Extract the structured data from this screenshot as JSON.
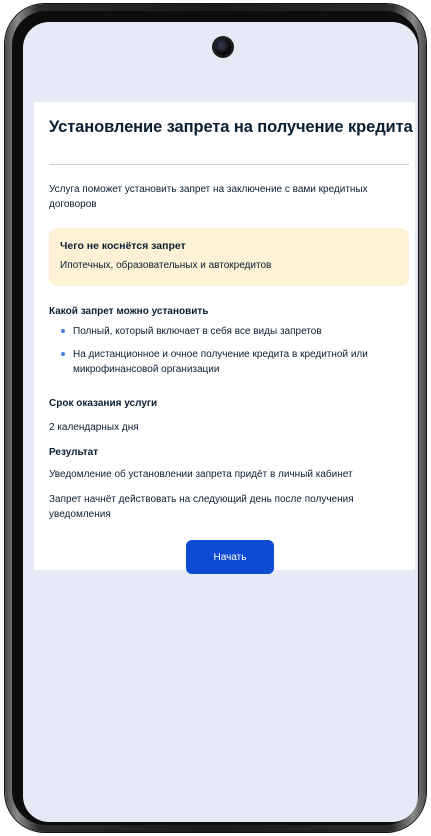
{
  "page": {
    "title": "Установление запрета на получение кредита",
    "intro": "Услуга поможет установить запрет на заключение с вами кредитных договоров",
    "notice": {
      "title": "Чего не коснётся запрет",
      "text": "Ипотечных, образовательных и автокредитов"
    },
    "ban_types": {
      "heading": "Какой запрет можно установить",
      "items": [
        "Полный, который включает в себя все виды запретов",
        "На дистанционное и очное получение кредита в кредитной или микрофинансовой организации"
      ]
    },
    "term": {
      "heading": "Срок оказания услуги",
      "value": "2 календарных дня"
    },
    "result": {
      "heading": "Результат",
      "lines": [
        "Уведомление об установлении запрета придёт в личный кабинет",
        "Запрет начнёт действовать на следующий день после получения уведомления"
      ]
    },
    "start_button": "Начать"
  },
  "colors": {
    "screen_bg": "#e5eaf6",
    "notice_bg": "#fdf1d6",
    "accent_button": "#0d4cd3",
    "bullet": "#4a82db",
    "text": "#0b1f33"
  },
  "icons": {
    "camera": "front-camera-icon",
    "bullet": "bullet-dot-icon"
  }
}
